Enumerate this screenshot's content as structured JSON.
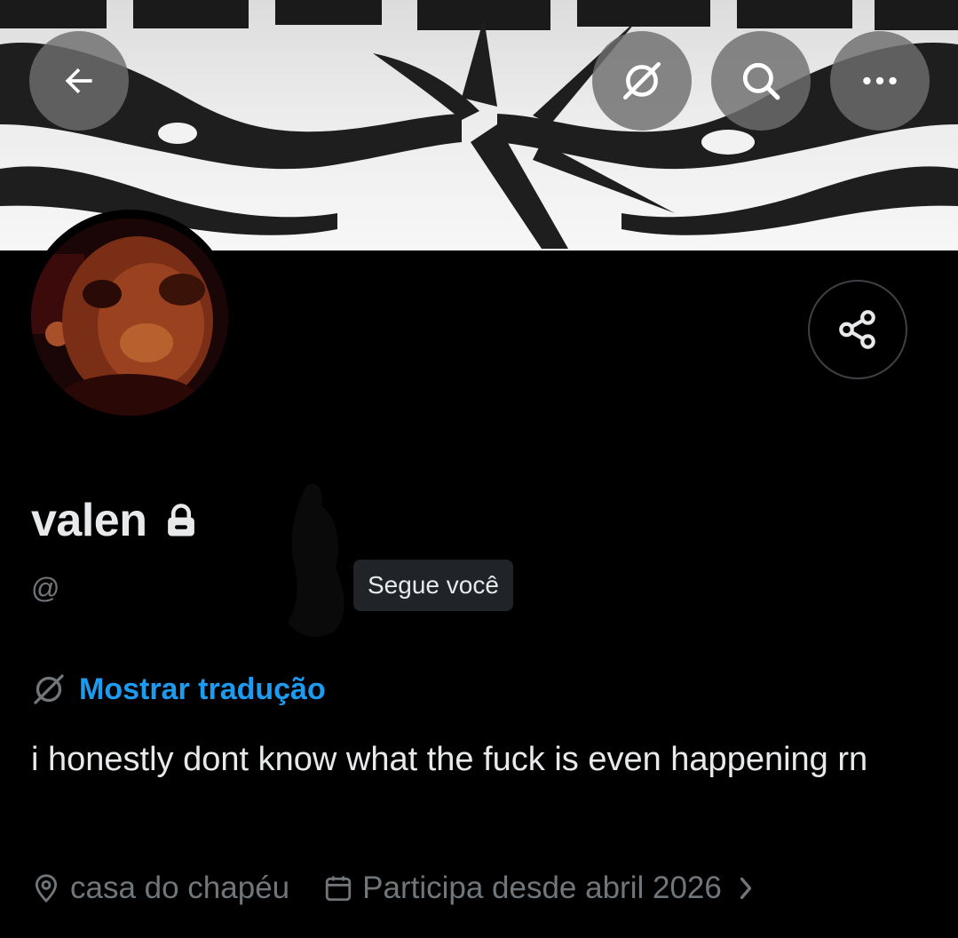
{
  "profile": {
    "name": "valen",
    "handle": "@",
    "follows_you_label": "Segue você",
    "show_translation_label": "Mostrar tradução",
    "bio": "i honestly dont know what the fuck is even happening rn",
    "location": "casa do chapéu",
    "joined": "Participa desde abril 2026"
  },
  "colors": {
    "background": "#000000",
    "text_primary": "#e7e9ea",
    "text_secondary": "#71767b",
    "link": "#1d9bf0",
    "badge_background": "#202327"
  },
  "icons": {
    "header_left": "back-arrow-icon",
    "header_right": [
      "grok-icon",
      "search-icon",
      "more-icon"
    ],
    "share": "share-icon",
    "lock": "lock-icon",
    "translate": "grok-icon",
    "location": "location-pin-icon",
    "joined": "calendar-icon",
    "expand": "chevron-right-icon"
  }
}
